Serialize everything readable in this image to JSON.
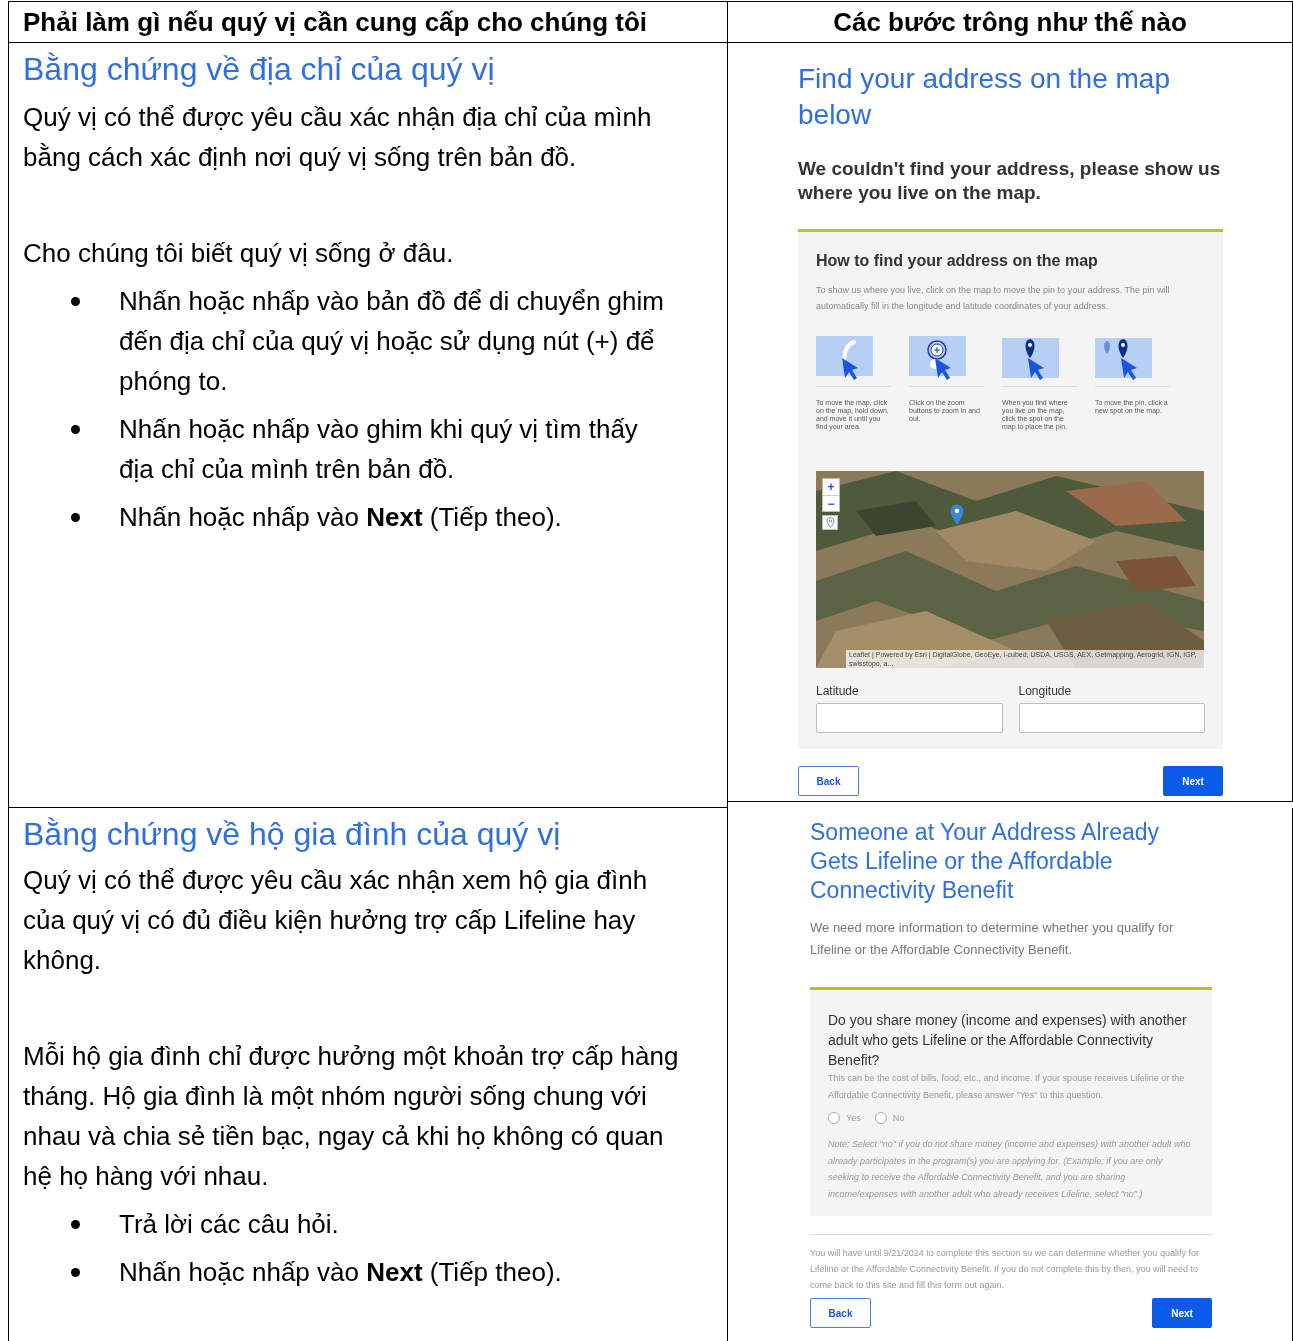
{
  "table": {
    "columns": [
      "Phải làm gì nếu quý vị cần cung cấp cho chúng tôi",
      "Các bước trông như thế nào"
    ],
    "rows": [
      {
        "left": {
          "title": "Bằng chứng về địa chỉ của quý vị",
          "blocks": [
            {
              "kind": "paragraph",
              "text": "Quý vị có thể được yêu cầu xác nhận địa chỉ của mình bằng cách xác định nơi quý vị sống trên bản đồ."
            },
            {
              "kind": "paragraph",
              "text": "Cho chúng tôi biết quý vị sống ở đâu."
            },
            {
              "kind": "bullets",
              "items": [
                "Nhấn hoặc nhấp vào bản đồ để di chuyển ghim đến địa chỉ của quý vị hoặc sử dụng nút (+) để phóng to.",
                "Nhấn hoặc nhấp vào ghim khi quý vị tìm thấy địa chỉ của mình trên bản đồ.",
                "Nhấn hoặc nhấp vào **Next** (Tiếp theo)."
              ]
            }
          ]
        },
        "right": {
          "kind": "map_step",
          "title": "Find your address on the map below",
          "subtitle": "We couldn't find your address, please show us where you live on the map.",
          "help": {
            "title": "How to find your address on the map",
            "text": "To show us where you live, click on the map to move the pin to your address. The pin will automatically fill in the longitude and latitude coordinates of your address.",
            "steps": [
              {
                "kind": "drag",
                "caption": "To move the map, click on the map, hold down, and move it until you find your area."
              },
              {
                "kind": "zoom",
                "caption": "Click on the zoom buttons to zoom in and out."
              },
              {
                "kind": "place",
                "caption": "When you find where you live on the map, click the spot on the map to place the pin."
              },
              {
                "kind": "move",
                "caption": "To move the pin, click a new spot on the map."
              }
            ]
          },
          "map": {
            "zoom_in": "+",
            "zoom_out": "−",
            "attribution": "Leaflet | Powered by Esri | DigitalGlobe, GeoEye, i-cubed, USDA, USGS, AEX, Getmapping, Aerogrid, IGN, IGP, swisstopo, a..."
          },
          "fields": [
            {
              "label": "Latitude"
            },
            {
              "label": "Longitude"
            }
          ],
          "back": "Back",
          "next": "Next"
        }
      },
      {
        "left": {
          "title": "Bằng chứng về hộ gia đình của quý vị",
          "blocks": [
            {
              "kind": "paragraph",
              "text": "Quý vị có thể được yêu cầu xác nhận xem hộ gia đình của quý vị có đủ điều kiện hưởng trợ cấp Lifeline hay không."
            },
            {
              "kind": "paragraph",
              "text": "Mỗi hộ gia đình chỉ được hưởng một khoản trợ cấp hàng tháng. Hộ gia đình là một nhóm người sống chung với nhau và chia sẻ tiền bạc, ngay cả khi họ không có quan hệ họ hàng với nhau."
            },
            {
              "kind": "bullets",
              "items": [
                "Trả lời các câu hỏi.",
                "Nhấn hoặc nhấp vào **Next** (Tiếp theo)."
              ]
            }
          ]
        },
        "right": {
          "kind": "question_step",
          "title": "Someone at Your Address Already Gets Lifeline or the Affordable Connectivity Benefit",
          "subtitle": "We need more information to determine whether you qualify for Lifeline or the Affordable Connectivity Benefit.",
          "question": "Do you share money (income and expenses) with another adult who gets Lifeline or the Affordable Connectivity Benefit?",
          "hint": "This can be the cost of bills, food, etc., and income. If your spouse receives Lifeline or the Affordable Connectivity Benefit, please answer \"Yes\" to this question.",
          "options": [
            {
              "label": "Yes",
              "selected": false
            },
            {
              "label": "No",
              "selected": false
            }
          ],
          "note": "Note: Select \"no\" if you do not share money (income and expenses) with another adult who already participates in the program(s) you are applying for. (Example: if you are only seeking to receive the Affordable Connectivity Benefit, and you are sharing income/expenses with another adult who already receives Lifeline, select \"no\".)",
          "footer": "You will have until 9/21/2024 to complete this section so we can determine whether you qualify for Lifeline or the Affordable Connectivity Benefit. If you do not complete this by then, you will need to come back to this site and fill this form out again.",
          "back": "Back",
          "next": "Next"
        }
      }
    ]
  }
}
